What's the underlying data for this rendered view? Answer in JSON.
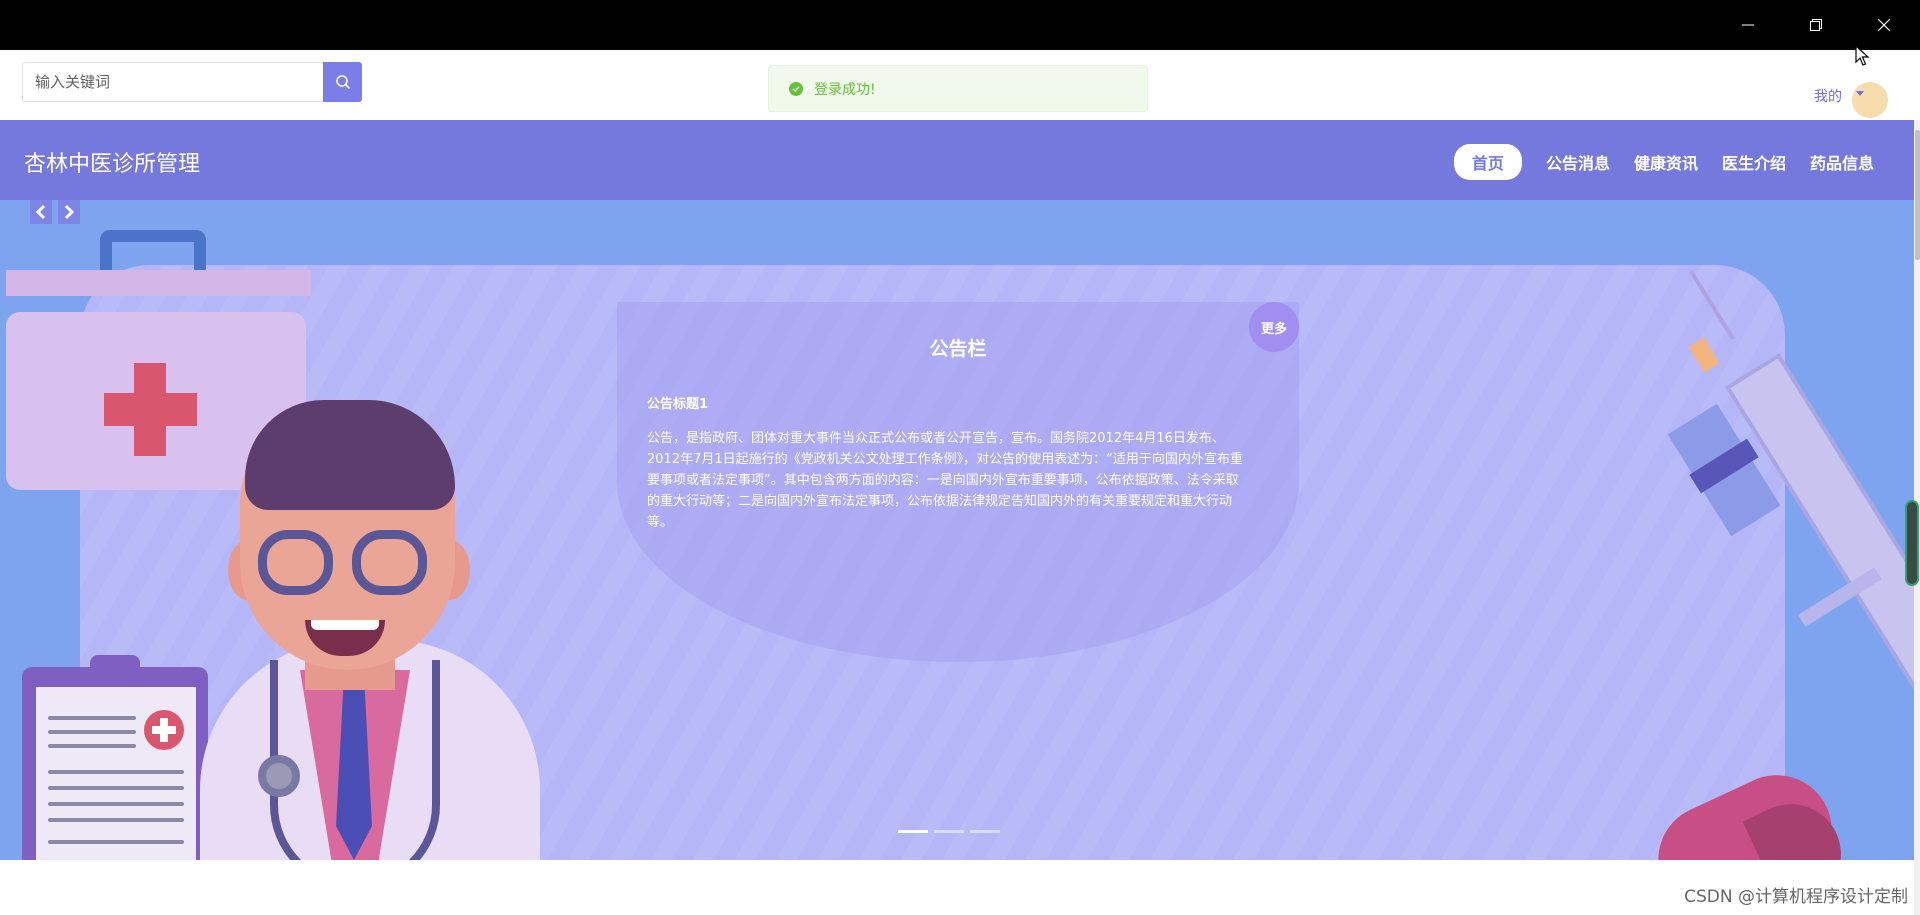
{
  "window": {
    "controls": [
      "minimize-icon",
      "restore-icon",
      "close-icon"
    ]
  },
  "search": {
    "placeholder": "输入关键词",
    "value": "",
    "icon": "search-icon"
  },
  "toast": {
    "message": "登录成功!",
    "type": "success",
    "color": "#67c23a"
  },
  "user_menu": {
    "label": "我的"
  },
  "header": {
    "site_title": "杏林中医诊所管理",
    "background": "#7579de",
    "nav": [
      {
        "label": "首页",
        "active": true
      },
      {
        "label": "公告消息",
        "active": false
      },
      {
        "label": "健康资讯",
        "active": false
      },
      {
        "label": "医生介绍",
        "active": false
      },
      {
        "label": "药品信息",
        "active": false
      }
    ]
  },
  "notice_board": {
    "title": "公告栏",
    "more_label": "更多",
    "heading": "公告标题1",
    "body": "公告，是指政府、团体对重大事件当众正式公布或者公开宣告，宣布。国务院2012年4月16日发布、2012年7月1日起施行的《党政机关公文处理工作条例》，对公告的使用表述为：“适用于向国内外宣布重要事项或者法定事项”。其中包含两方面的内容：一是向国内外宣布重要事项，公布依据政策、法令采取的重大行动等；二是向国内外宣布法定事项，公布依据法律规定告知国内外的有关重要规定和重大行动等。"
  },
  "carousel": {
    "prev_icon": "chevron-left-icon",
    "next_icon": "chevron-right-icon",
    "slides": 3,
    "active_index": 0
  },
  "watermark": "CSDN @计算机程序设计定制"
}
